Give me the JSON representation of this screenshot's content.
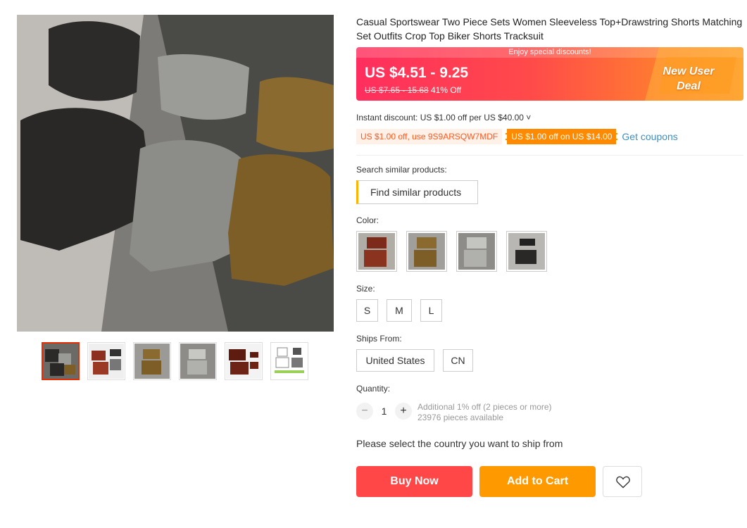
{
  "product": {
    "title": "Casual Sportswear Two Piece Sets Women Sleeveless Top+Drawstring Shorts Matching Set Outfits Crop Top Biker Shorts Tracksuit"
  },
  "price": {
    "promo_strip": "Enjoy special discounts!",
    "current": "US $4.51 - 9.25",
    "original": "US $7.65 - 15.68",
    "discount": "41% Off",
    "new_user_line1": "New User",
    "new_user_line2": "Deal"
  },
  "coupons": {
    "instant": "Instant discount: US $1.00 off per US $40.00 ˅",
    "code_coupon": "US $1.00 off, use 9S9ARSQW7MDF",
    "store_coupon": "US $1.00 off on US $14.00",
    "get_coupons": "Get coupons"
  },
  "similar": {
    "label": "Search similar products:",
    "button": "Find similar products"
  },
  "color": {
    "label": "Color:",
    "options": [
      "brown",
      "khaki",
      "gray",
      "black"
    ]
  },
  "size": {
    "label": "Size:",
    "options": [
      "S",
      "M",
      "L"
    ]
  },
  "ships_from": {
    "label": "Ships From:",
    "options": [
      "United States",
      "CN"
    ]
  },
  "quantity": {
    "label": "Quantity:",
    "value": "1",
    "minus": "−",
    "plus": "+",
    "info_line1": "Additional 1% off (2 pieces or more)",
    "info_line2": "23976 pieces available"
  },
  "shipping_message": "Please select the country you want to ship from",
  "actions": {
    "buy_now": "Buy Now",
    "add_to_cart": "Add to Cart"
  },
  "colors": {
    "price_gradient_start": "#ff2e5e",
    "price_gradient_end": "#ff9a2c",
    "buy_now": "#ff4747",
    "add_to_cart": "#ff9900",
    "coupon_accent": "#ff8a00",
    "link": "#3e8fc4",
    "active_thumb": "#e62e04"
  }
}
